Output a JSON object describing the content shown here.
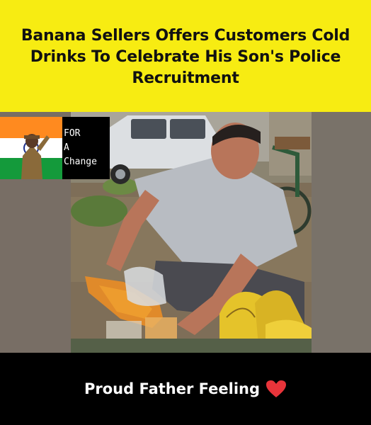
{
  "headline": "Banana Sellers Offers Customers Cold Drinks To Celebrate His Son's Police Recruitment",
  "badge": {
    "lines": [
      "FOR",
      "A",
      "Change"
    ],
    "icon": "saluting-police-flag-icon"
  },
  "caption": {
    "text": "Proud Father Feeling",
    "icon": "red-heart-icon"
  },
  "colors": {
    "header_bg": "#f7ec12",
    "footer_bg": "#000000",
    "heart": "#e8343a"
  }
}
